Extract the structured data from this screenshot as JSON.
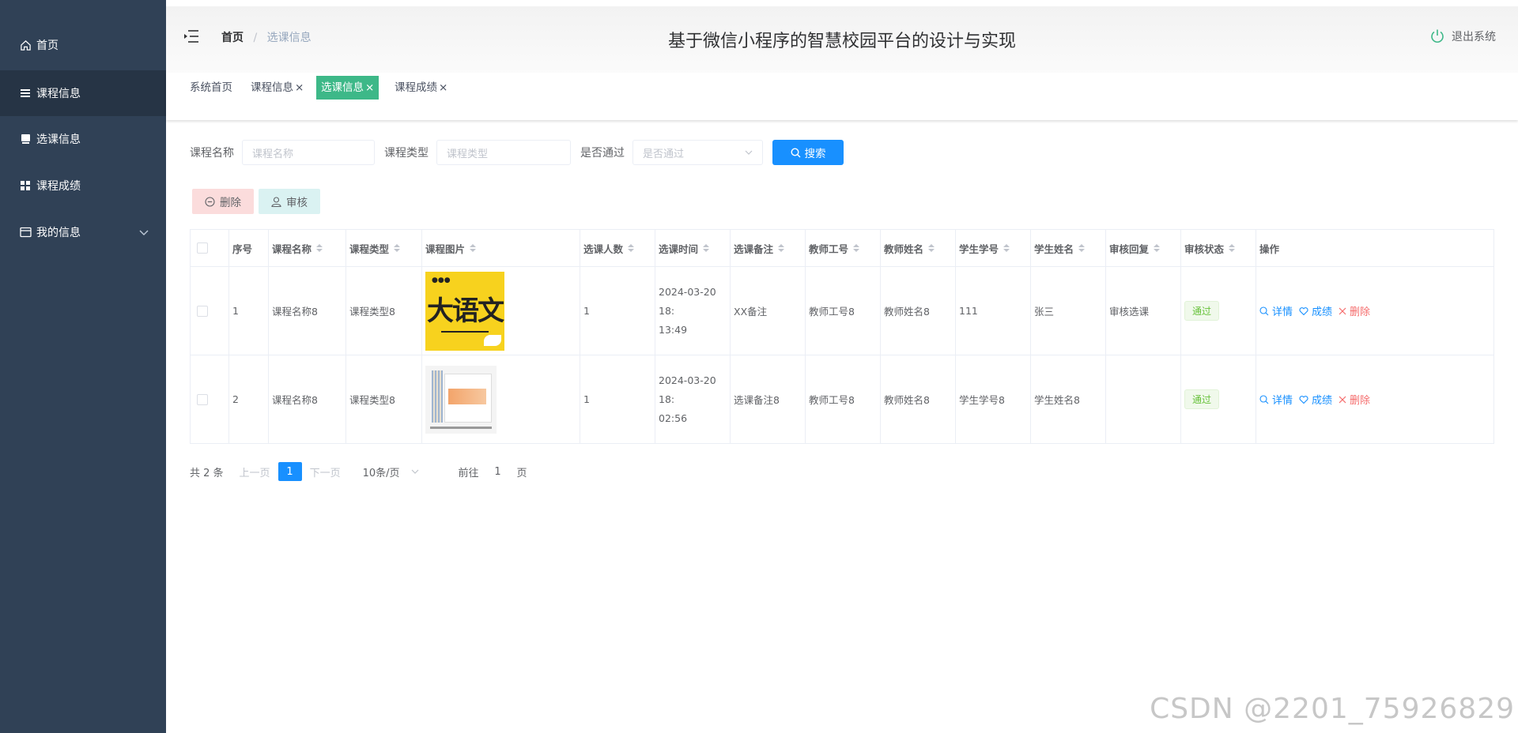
{
  "sidebar": {
    "items": [
      {
        "label": "首页",
        "icon": "home-icon"
      },
      {
        "label": "课程信息",
        "icon": "list-icon"
      },
      {
        "label": "选课信息",
        "icon": "book-icon"
      },
      {
        "label": "课程成绩",
        "icon": "grid-icon"
      },
      {
        "label": "我的信息",
        "icon": "card-icon"
      }
    ]
  },
  "header": {
    "breadcrumb_home": "首页",
    "breadcrumb_sep": "/",
    "breadcrumb_current": "选课信息",
    "title": "基于微信小程序的智慧校园平台的设计与实现",
    "logout_label": "退出系统"
  },
  "tags": {
    "items": [
      {
        "label": "系统首页",
        "closable": false
      },
      {
        "label": "课程信息",
        "closable": true
      },
      {
        "label": "选课信息",
        "closable": true,
        "active": true
      },
      {
        "label": "课程成绩",
        "closable": true
      }
    ],
    "close_glyph": "×"
  },
  "search": {
    "course_name_label": "课程名称",
    "course_name_placeholder": "课程名称",
    "course_type_label": "课程类型",
    "course_type_placeholder": "课程类型",
    "passed_label": "是否通过",
    "passed_placeholder": "是否通过",
    "search_button": "搜索"
  },
  "actions": {
    "delete_label": "删除",
    "audit_label": "审核"
  },
  "table": {
    "headers": [
      "序号",
      "课程名称",
      "课程类型",
      "课程图片",
      "选课人数",
      "选课时间",
      "选课备注",
      "教师工号",
      "教师姓名",
      "学生学号",
      "学生姓名",
      "审核回复",
      "审核状态",
      "操作"
    ],
    "rows": [
      {
        "index": "1",
        "course_name": "课程名称8",
        "course_type": "课程类型8",
        "image_text": "大语文",
        "count": "1",
        "time_line1": "2024-03-20 18:",
        "time_line2": "13:49",
        "note": "XX备注",
        "teacher_no": "教师工号8",
        "teacher_name": "教师姓名8",
        "student_no": "111",
        "student_name": "张三",
        "reply": "审核选课",
        "status": "通过"
      },
      {
        "index": "2",
        "course_name": "课程名称8",
        "course_type": "课程类型8",
        "image_text": "",
        "count": "1",
        "time_line1": "2024-03-20 18:",
        "time_line2": "02:56",
        "note": "选课备注8",
        "teacher_no": "教师工号8",
        "teacher_name": "教师姓名8",
        "student_no": "学生学号8",
        "student_name": "学生姓名8",
        "reply": "",
        "status": "通过"
      }
    ],
    "op_detail": "详情",
    "op_score": "成绩",
    "op_delete": "删除"
  },
  "pagination": {
    "total": "共 2 条",
    "prev": "上一页",
    "current": "1",
    "next": "下一页",
    "page_size": "10条/页",
    "goto_label": "前往",
    "goto_value": "1",
    "page_unit": "页"
  },
  "watermark": "CSDN @2201_75926829",
  "colors": {
    "sidebar_bg": "#304156",
    "accent_blue": "#1890ff",
    "active_tag": "#3db888",
    "status_green": "#67c23a"
  }
}
